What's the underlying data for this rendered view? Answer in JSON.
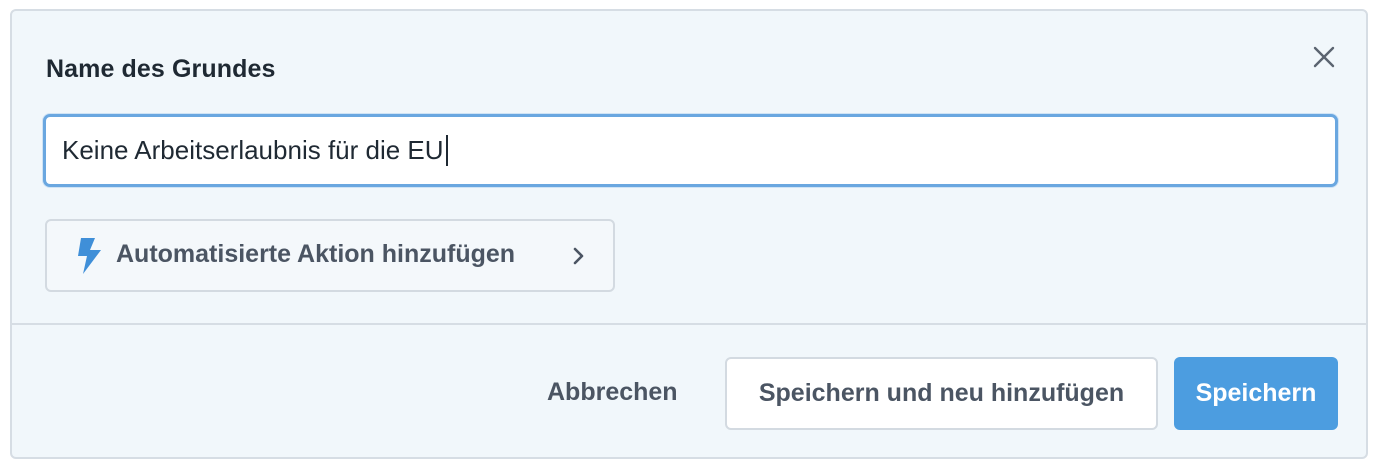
{
  "dialog": {
    "title": "Name des Grundes",
    "close_icon": "close-icon"
  },
  "reason_input": {
    "value": "Keine Arbeitserlaubnis für die EU",
    "focused": true
  },
  "automation": {
    "label": "Automatisierte Aktion hinzufügen",
    "icon": "lightning-bolt-icon",
    "chevron": "chevron-right-icon"
  },
  "footer": {
    "cancel_label": "Abbrechen",
    "save_and_new_label": "Speichern und neu hinzufügen",
    "save_label": "Speichern"
  },
  "colors": {
    "panel_background": "#f1f7fb",
    "accent": "#4c9de0",
    "focus_border": "#6aa7e0",
    "text_dark": "#1f2933",
    "text_muted": "#4b5563",
    "border": "#d6dde4"
  }
}
